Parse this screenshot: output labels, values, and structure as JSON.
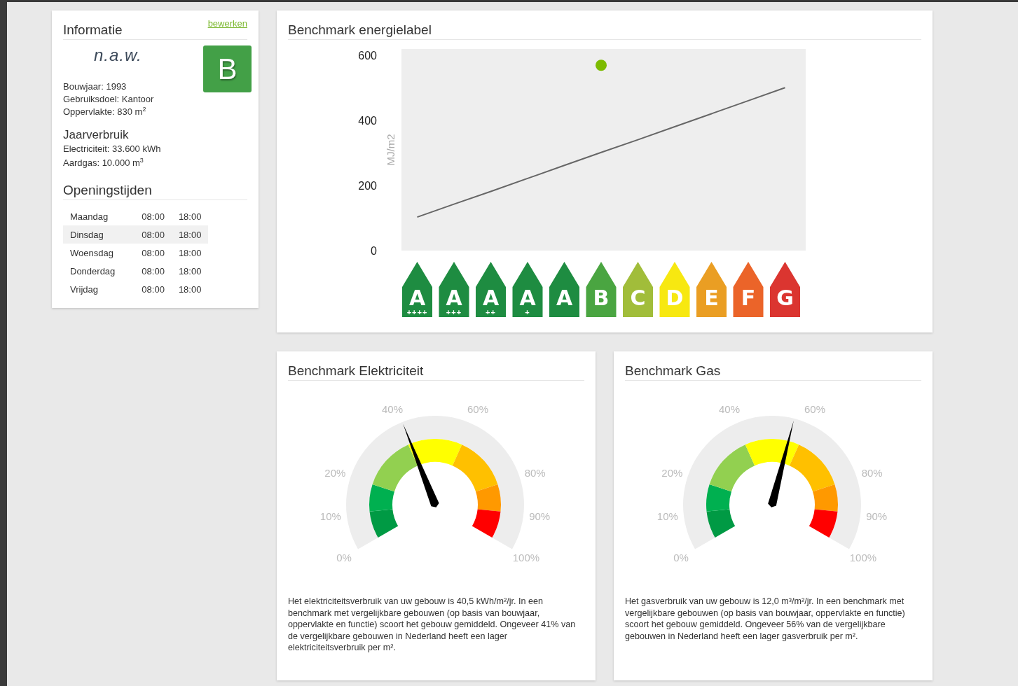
{
  "info": {
    "title": "Informatie",
    "edit_link": "bewerken",
    "naw": "n.a.w.",
    "label": {
      "letter": "B",
      "color": "#43a047"
    },
    "details": [
      "Bouwjaar: 1993",
      "Gebruiksdoel: Kantoor",
      "Oppervlakte: 830 m$^{2}$"
    ],
    "usage_title": "Jaarverbruik",
    "usage": [
      "Electriciteit: 33.600 kWh",
      "Aardgas: 10.000 m$^{3}$"
    ]
  },
  "hours": {
    "title": "Openingstijden",
    "rows": [
      {
        "day": "Maandag",
        "open": "08:00",
        "close": "18:00",
        "highlighted": false
      },
      {
        "day": "Dinsdag",
        "open": "08:00",
        "close": "18:00",
        "highlighted": true
      },
      {
        "day": "Woensdag",
        "open": "08:00",
        "close": "18:00",
        "highlighted": false
      },
      {
        "day": "Donderdag",
        "open": "08:00",
        "close": "18:00",
        "highlighted": false
      },
      {
        "day": "Vrijdag",
        "open": "08:00",
        "close": "18:00",
        "highlighted": false
      }
    ]
  },
  "energy": {
    "title": "Benchmark energielabel",
    "chart_data": {
      "type": "line",
      "ylabel": "MJ/m2",
      "ylim": [
        0,
        620
      ],
      "yticks": [
        0,
        200,
        400,
        600
      ],
      "series": [
        {
          "color": "#666666",
          "values": [
            103,
            143,
            182,
            222,
            262,
            302,
            341,
            381,
            421,
            461,
            501
          ]
        },
        {
          "color": "#7cbb00",
          "marker": true,
          "values": [
            null,
            null,
            null,
            null,
            null,
            570,
            null,
            null,
            null,
            null,
            null
          ]
        }
      ]
    },
    "labels": [
      {
        "letter": "A",
        "plus": "++++",
        "color": "#1e8c41"
      },
      {
        "letter": "A",
        "plus": "+++",
        "color": "#1e8c41"
      },
      {
        "letter": "A",
        "plus": "++",
        "color": "#1e8c41"
      },
      {
        "letter": "A",
        "plus": "+",
        "color": "#1e8c41"
      },
      {
        "letter": "A",
        "color": "#1e8c41"
      },
      {
        "letter": "B",
        "color": "#4aa541"
      },
      {
        "letter": "C",
        "color": "#a1bd3a"
      },
      {
        "letter": "D",
        "color": "#f7e811"
      },
      {
        "letter": "E",
        "color": "#ea9e23"
      },
      {
        "letter": "F",
        "color": "#eb6429"
      },
      {
        "letter": "G",
        "color": "#db3530"
      }
    ]
  },
  "gauges": [
    {
      "title": "Benchmark Elektriciteit",
      "level": 0.41,
      "ticks": [
        "0%",
        "10%",
        "20%",
        "40%",
        "60%",
        "80%",
        "90%",
        "100%"
      ],
      "bands": [
        {
          "color": "#009a44"
        },
        {
          "color": "#00b050"
        },
        {
          "color": "#92d050"
        },
        {
          "color": "#ffff00"
        },
        {
          "color": "#ffc000"
        },
        {
          "color": "#ff9900"
        },
        {
          "color": "#ff0000"
        }
      ],
      "text": "Het elektriciteitsverbruik van uw gebouw is 40,5 kWh/m²/jr. In een benchmark met vergelijkbare gebouwen (op basis van bouwjaar, oppervlakte en functie) scoort het gebouw gemiddeld. Ongeveer 41% van de vergelijkbare gebouwen in Nederland heeft een lager elektriciteitsverbruik per m²."
    },
    {
      "title": "Benchmark Gas",
      "level": 0.56,
      "ticks": [
        "0%",
        "10%",
        "20%",
        "40%",
        "60%",
        "80%",
        "90%",
        "100%"
      ],
      "bands": [
        {
          "color": "#009a44"
        },
        {
          "color": "#00b050"
        },
        {
          "color": "#92d050"
        },
        {
          "color": "#ffff00"
        },
        {
          "color": "#ffc000"
        },
        {
          "color": "#ff9900"
        },
        {
          "color": "#ff0000"
        }
      ],
      "text": "Het gasverbruik van uw gebouw is 12,0 m³/m²/jr. In een benchmark met vergelijkbare gebouwen (op basis van bouwjaar, oppervlakte en functie) scoort het gebouw gemiddeld. Ongeveer 56% van de vergelijkbare gebouwen in Nederland heeft een lager gasverbruik per m²."
    }
  ]
}
